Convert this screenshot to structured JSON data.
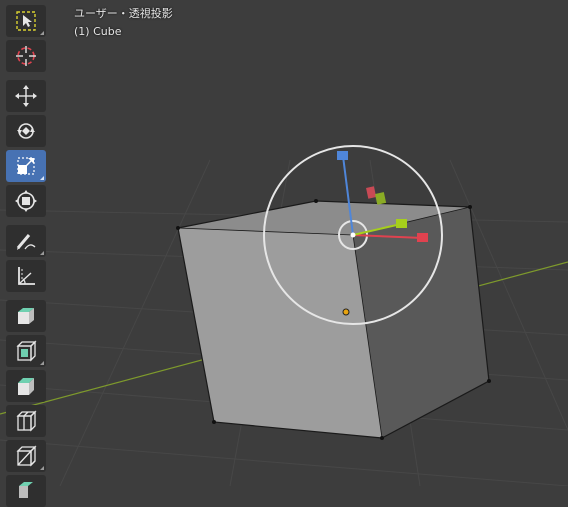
{
  "viewport": {
    "view_name": "ユーザー・透視投影",
    "object_label": "(1) Cube"
  },
  "toolbar": {
    "tools": [
      {
        "name": "select-box-tool",
        "icon": "select-box-icon",
        "active": false
      },
      {
        "name": "cursor-tool",
        "icon": "cursor-icon",
        "active": false
      },
      {
        "name": "move-tool",
        "icon": "move-icon",
        "active": false
      },
      {
        "name": "rotate-tool",
        "icon": "rotate-icon",
        "active": false
      },
      {
        "name": "scale-tool",
        "icon": "scale-icon",
        "active": true
      },
      {
        "name": "transform-tool",
        "icon": "transform-icon",
        "active": false
      },
      {
        "name": "annotate-tool",
        "icon": "annotate-icon",
        "active": false
      },
      {
        "name": "measure-tool",
        "icon": "measure-icon",
        "active": false
      },
      {
        "name": "add-cube-tool",
        "icon": "add-cube-icon",
        "active": false
      },
      {
        "name": "extrude-tool",
        "icon": "extrude-icon",
        "active": false
      },
      {
        "name": "inset-tool",
        "icon": "inset-icon",
        "active": false
      },
      {
        "name": "bevel-tool",
        "icon": "bevel-icon",
        "active": false
      },
      {
        "name": "loop-cut-tool",
        "icon": "loop-cut-icon",
        "active": false
      },
      {
        "name": "knife-tool",
        "icon": "knife-icon",
        "active": false
      }
    ]
  },
  "colors": {
    "background": "#3d3d3d",
    "active_tool": "#4772b3",
    "axis_x": "#e0424f",
    "axis_y": "#a6cf1c",
    "axis_z": "#4f86d9"
  }
}
